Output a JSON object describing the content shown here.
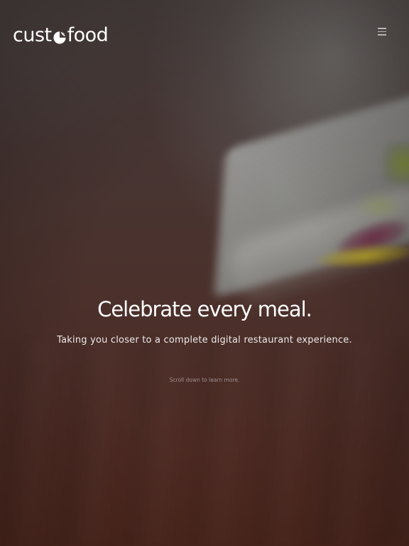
{
  "header": {
    "logo_left": "cust",
    "logo_right": "food",
    "logo_mark_icon": "plate-and-fork-icon",
    "menu_icon": "hamburger-menu-icon"
  },
  "hero": {
    "headline": "Celebrate every meal.",
    "subline": "Taking you closer to a complete digital restaurant experience.",
    "scroll_hint": "Scroll down to learn more."
  },
  "colors": {
    "text": "#ffffff",
    "background_top": "#4a403e",
    "background_bottom": "#50291f"
  }
}
